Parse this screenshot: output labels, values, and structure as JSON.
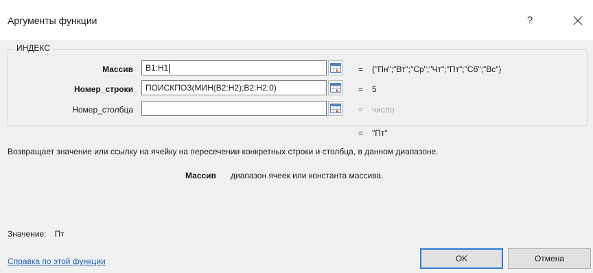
{
  "dialog": {
    "title": "Аргументы функции",
    "help_symbol": "?",
    "close_symbol": "✕"
  },
  "function": {
    "name": "ИНДЕКС",
    "args": [
      {
        "label": "Массив",
        "value": "B1:H1",
        "result": "{\"Пн\";\"Вт\";\"Ср\";\"Чт\";\"Пт\";\"Сб\";\"Вс\"}",
        "bold": true
      },
      {
        "label": "Номер_строки",
        "value": "ПОИСКПОЗ(МИН(B2:H2);B2:H2;0)",
        "result": "5",
        "bold": true
      },
      {
        "label": "Номер_столбца",
        "value": "",
        "result": "число",
        "bold": false
      }
    ],
    "eq_sign": "=",
    "final_result": "\"Пт\""
  },
  "description": "Возвращает значение или ссылку на ячейку на пересечении конкретных строки и столбца, в данном диапазоне.",
  "arg_description": {
    "name": "Массив",
    "text": "диапазон ячеек или константа массива."
  },
  "value_line": {
    "label": "Значение:",
    "value": "Пт"
  },
  "footer": {
    "help_link": "Справка по этой функции",
    "ok": "OK",
    "cancel": "Отмена"
  }
}
